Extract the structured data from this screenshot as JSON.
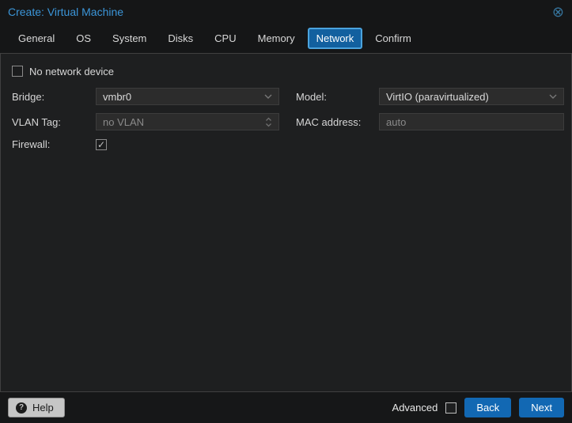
{
  "window": {
    "title": "Create: Virtual Machine",
    "close_glyph": "⊗"
  },
  "tabs": [
    {
      "label": "General",
      "active": false
    },
    {
      "label": "OS",
      "active": false
    },
    {
      "label": "System",
      "active": false
    },
    {
      "label": "Disks",
      "active": false
    },
    {
      "label": "CPU",
      "active": false
    },
    {
      "label": "Memory",
      "active": false
    },
    {
      "label": "Network",
      "active": true
    },
    {
      "label": "Confirm",
      "active": false
    }
  ],
  "form": {
    "no_network": {
      "label": "No network device",
      "checked": false
    },
    "bridge": {
      "label": "Bridge:",
      "value": "vmbr0",
      "type": "select"
    },
    "vlan": {
      "label": "VLAN Tag:",
      "placeholder": "no VLAN",
      "type": "spinner"
    },
    "firewall": {
      "label": "Firewall:",
      "checked": true
    },
    "model": {
      "label": "Model:",
      "value": "VirtIO (paravirtualized)",
      "type": "select"
    },
    "mac": {
      "label": "MAC address:",
      "placeholder": "auto",
      "type": "text"
    }
  },
  "footer": {
    "help_label": "Help",
    "help_glyph": "?",
    "advanced_label": "Advanced",
    "advanced_checked": false,
    "back_label": "Back",
    "next_label": "Next"
  },
  "glyphs": {
    "check": "✓"
  },
  "colors": {
    "title_blue": "#3b95d8",
    "active_tab_bg": "#12609f",
    "active_tab_border": "#4ba3dd",
    "button_blue": "#1268b3",
    "content_bg": "#1e1f20",
    "field_bg": "#2c2c2c",
    "muted_text": "#8a8a8a"
  }
}
